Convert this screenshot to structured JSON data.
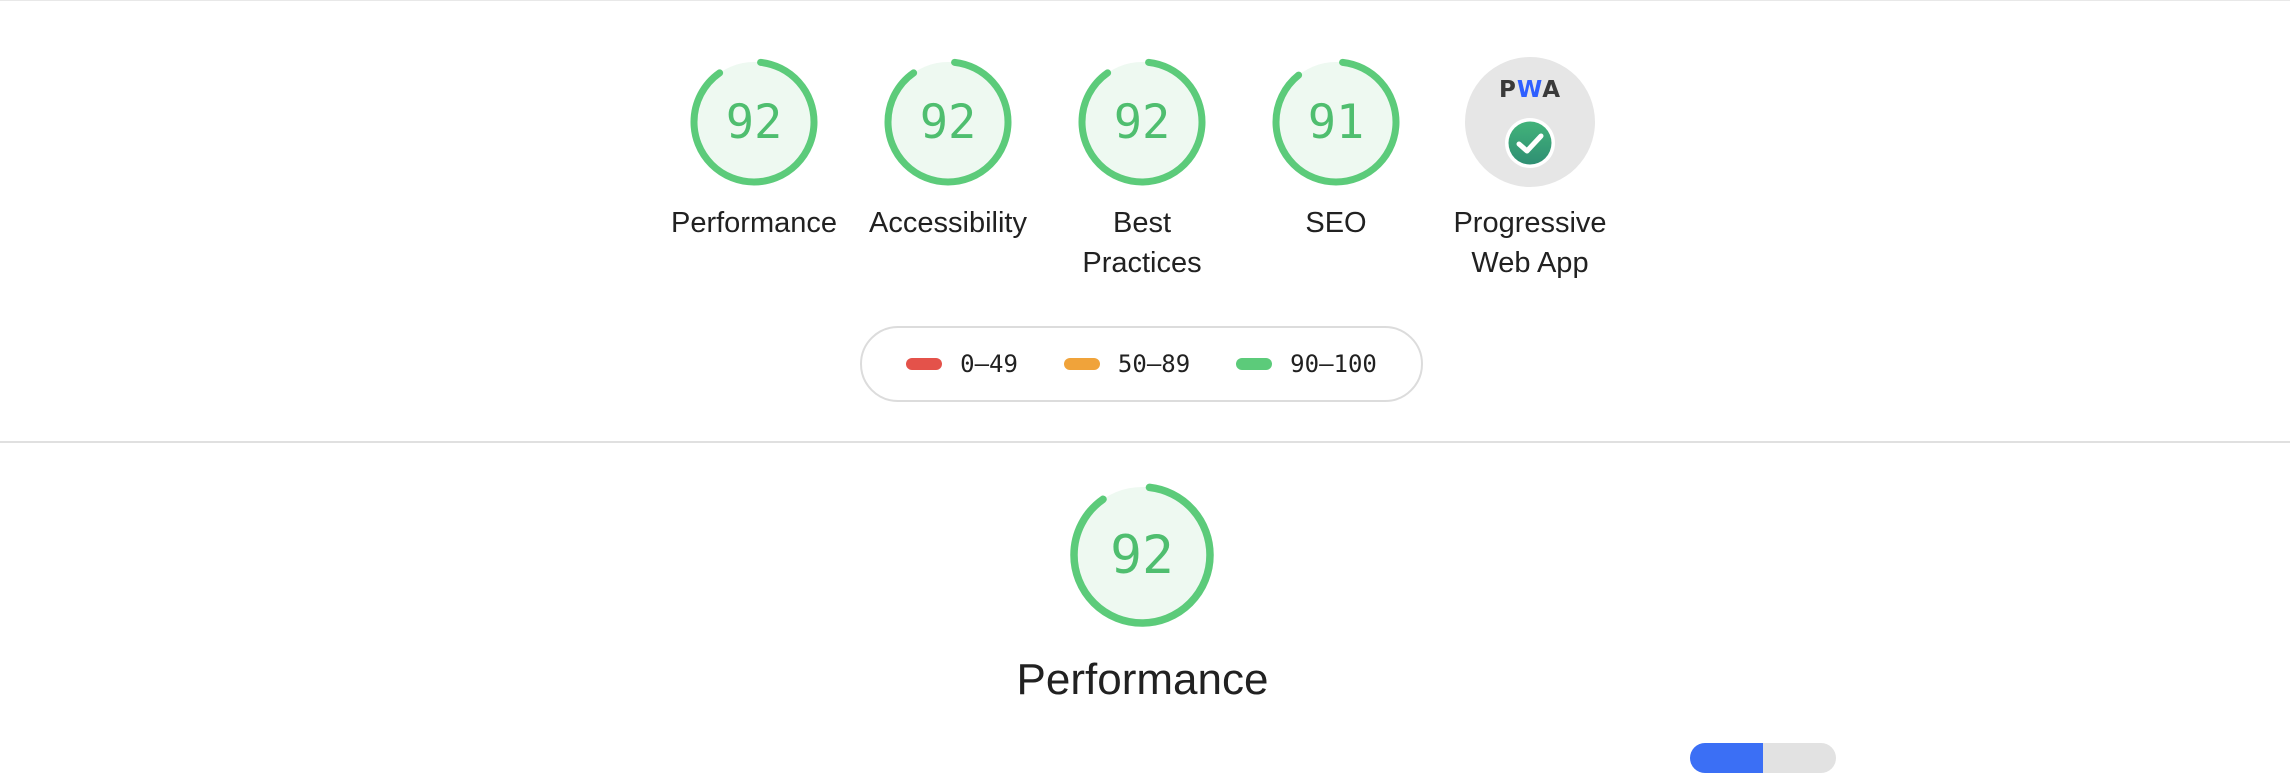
{
  "summary": {
    "gauges": [
      {
        "name": "Performance",
        "score": "92",
        "value": 92
      },
      {
        "name": "Accessibility",
        "score": "92",
        "value": 92
      },
      {
        "name": "Best Practices",
        "score": "92",
        "value": 92
      },
      {
        "name": "SEO",
        "score": "91",
        "value": 91
      }
    ],
    "pwa": {
      "badge_text_p": "P",
      "badge_text_w": "W",
      "badge_text_a": "A",
      "label": "Progressive Web App",
      "icon": "check-badge-icon"
    }
  },
  "legend": {
    "items": [
      {
        "range": "0–49",
        "color": "#e4524a"
      },
      {
        "range": "50–89",
        "color": "#f0a33a"
      },
      {
        "range": "90–100",
        "color": "#5ccb7a"
      }
    ]
  },
  "category": {
    "score": "92",
    "value": 92,
    "title": "Performance"
  },
  "colors": {
    "pass": "#4fbe6f",
    "pass_fill": "#eaf8ee",
    "track": "#e6f3e9"
  }
}
